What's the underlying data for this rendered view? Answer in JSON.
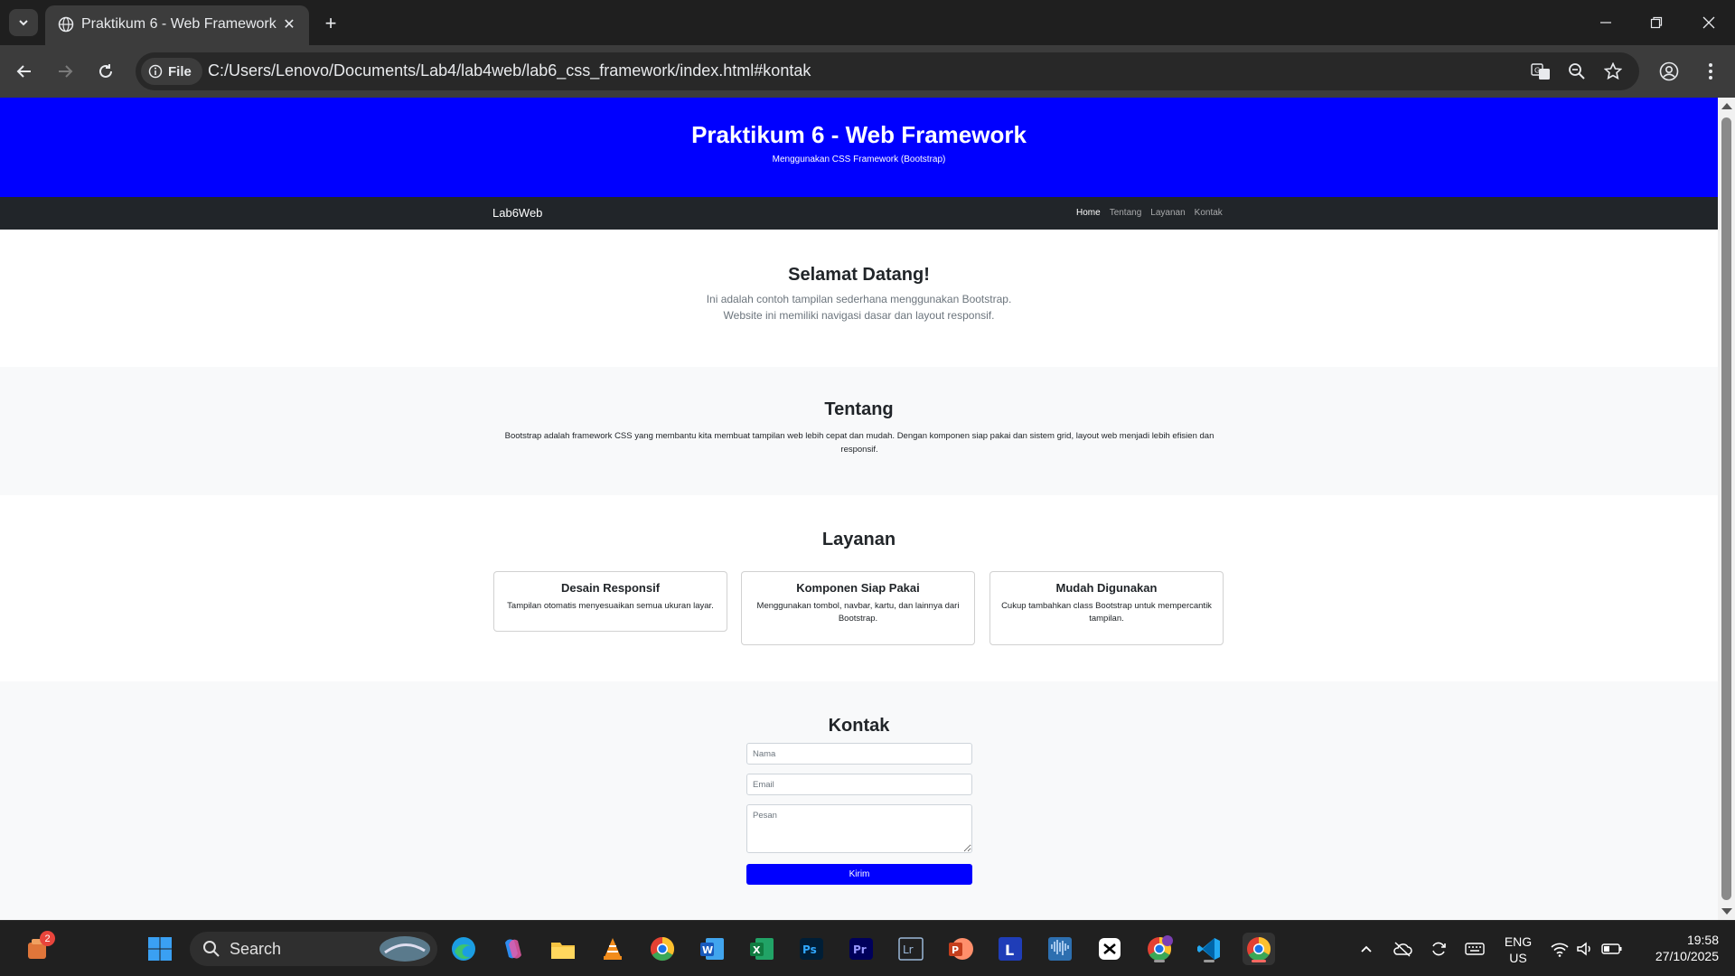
{
  "browser": {
    "tab_title": "Praktikum 6 - Web Framework",
    "file_chip": "File",
    "url": "C:/Users/Lenovo/Documents/Lab4/lab4web/lab6_css_framework/index.html#kontak"
  },
  "page": {
    "hero": {
      "title": "Praktikum 6 - Web Framework",
      "subtitle": "Menggunakan CSS Framework (Bootstrap)"
    },
    "navbar": {
      "brand": "Lab6Web",
      "links": [
        "Home",
        "Tentang",
        "Layanan",
        "Kontak"
      ]
    },
    "welcome": {
      "heading": "Selamat Datang!",
      "line1": "Ini adalah contoh tampilan sederhana menggunakan Bootstrap.",
      "line2": "Website ini memiliki navigasi dasar dan layout responsif."
    },
    "about": {
      "heading": "Tentang",
      "text": "Bootstrap adalah framework CSS yang membantu kita membuat tampilan web lebih cepat dan mudah. Dengan komponen siap pakai dan sistem grid, layout web menjadi lebih efisien dan responsif."
    },
    "services": {
      "heading": "Layanan",
      "cards": [
        {
          "title": "Desain Responsif",
          "text": "Tampilan otomatis menyesuaikan semua ukuran layar."
        },
        {
          "title": "Komponen Siap Pakai",
          "text": "Menggunakan tombol, navbar, kartu, dan lainnya dari Bootstrap."
        },
        {
          "title": "Mudah Digunakan",
          "text": "Cukup tambahkan class Bootstrap untuk mempercantik tampilan."
        }
      ]
    },
    "contact": {
      "heading": "Kontak",
      "name_placeholder": "Nama",
      "email_placeholder": "Email",
      "message_placeholder": "Pesan",
      "submit_label": "Kirim"
    }
  },
  "taskbar": {
    "search_label": "Search",
    "widget_badge": "2",
    "lang_top": "ENG",
    "lang_bottom": "US",
    "time": "19:58",
    "date": "27/10/2025",
    "apps": [
      "widgets",
      "start",
      "search",
      "edge",
      "copilot",
      "file-explorer",
      "vlc",
      "chrome",
      "word",
      "excel",
      "photoshop",
      "premiere",
      "lightroom",
      "powerpoint",
      "l-app",
      "audio-app",
      "capcut",
      "chrome-profile",
      "vscode",
      "chrome-active"
    ]
  }
}
